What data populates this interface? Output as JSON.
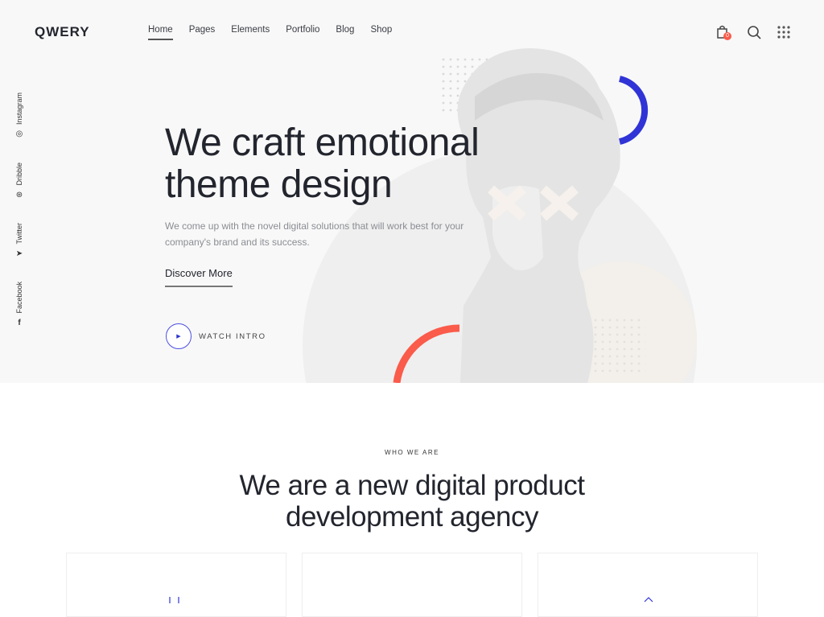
{
  "brand": "QWERY",
  "nav": [
    {
      "label": "Home",
      "active": true
    },
    {
      "label": "Pages"
    },
    {
      "label": "Elements"
    },
    {
      "label": "Portfolio"
    },
    {
      "label": "Blog"
    },
    {
      "label": "Shop"
    }
  ],
  "header_icons": {
    "cart": "shopping-bag-icon",
    "cart_count": "0",
    "search": "search-icon",
    "menu": "grid-menu-icon"
  },
  "social": [
    {
      "label": "Instagram",
      "icon": "instagram-icon"
    },
    {
      "label": "Dribble",
      "icon": "dribbble-icon"
    },
    {
      "label": "Twitter",
      "icon": "twitter-icon"
    },
    {
      "label": "Facebook",
      "icon": "facebook-icon"
    }
  ],
  "hero": {
    "title_line1": "We craft emotional",
    "title_line2": "theme design",
    "description": "We come up with the novel digital solutions that will work best for your company's brand and its success.",
    "cta": "Discover More",
    "watch": "WATCH INTRO"
  },
  "about": {
    "eyebrow": "WHO WE ARE",
    "title_line1": "We are a new digital product",
    "title_line2": "development agency"
  },
  "colors": {
    "accent_blue": "#3034d6",
    "accent_red": "#fa5b4a",
    "badge": "#fa5b4a"
  }
}
